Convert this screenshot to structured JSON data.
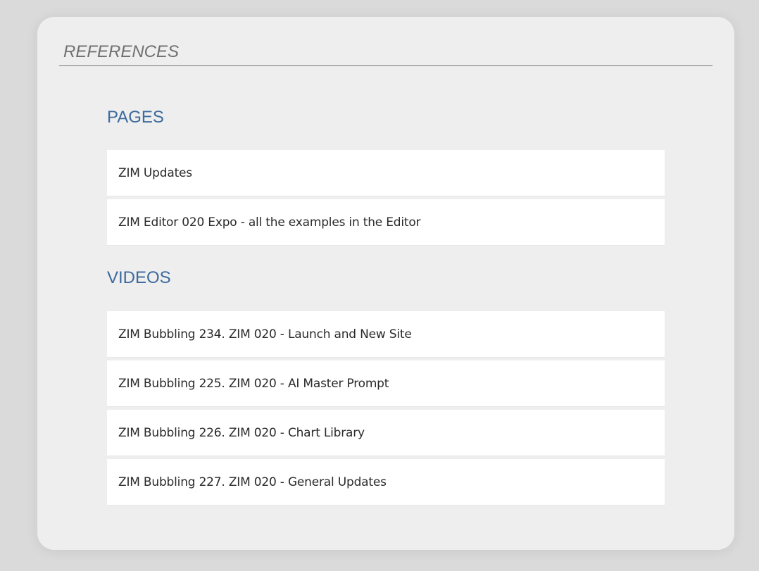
{
  "panel": {
    "title": "REFERENCES"
  },
  "pages": {
    "heading": "PAGES",
    "items": [
      {
        "label": "ZIM Updates"
      },
      {
        "label": "ZIM Editor 020 Expo - all the examples in the Editor"
      }
    ]
  },
  "videos": {
    "heading": "VIDEOS",
    "items": [
      {
        "label": "ZIM Bubbling 234. ZIM 020 - Launch and New Site"
      },
      {
        "label": "ZIM Bubbling 225. ZIM 020 - AI Master Prompt"
      },
      {
        "label": "ZIM Bubbling 226. ZIM 020 - Chart Library"
      },
      {
        "label": "ZIM Bubbling 227. ZIM 020 - General Updates"
      }
    ]
  },
  "colors": {
    "heading": "#3d6a9d",
    "title": "#707070",
    "panel_bg": "#eeeeee",
    "item_bg": "#ffffff"
  }
}
